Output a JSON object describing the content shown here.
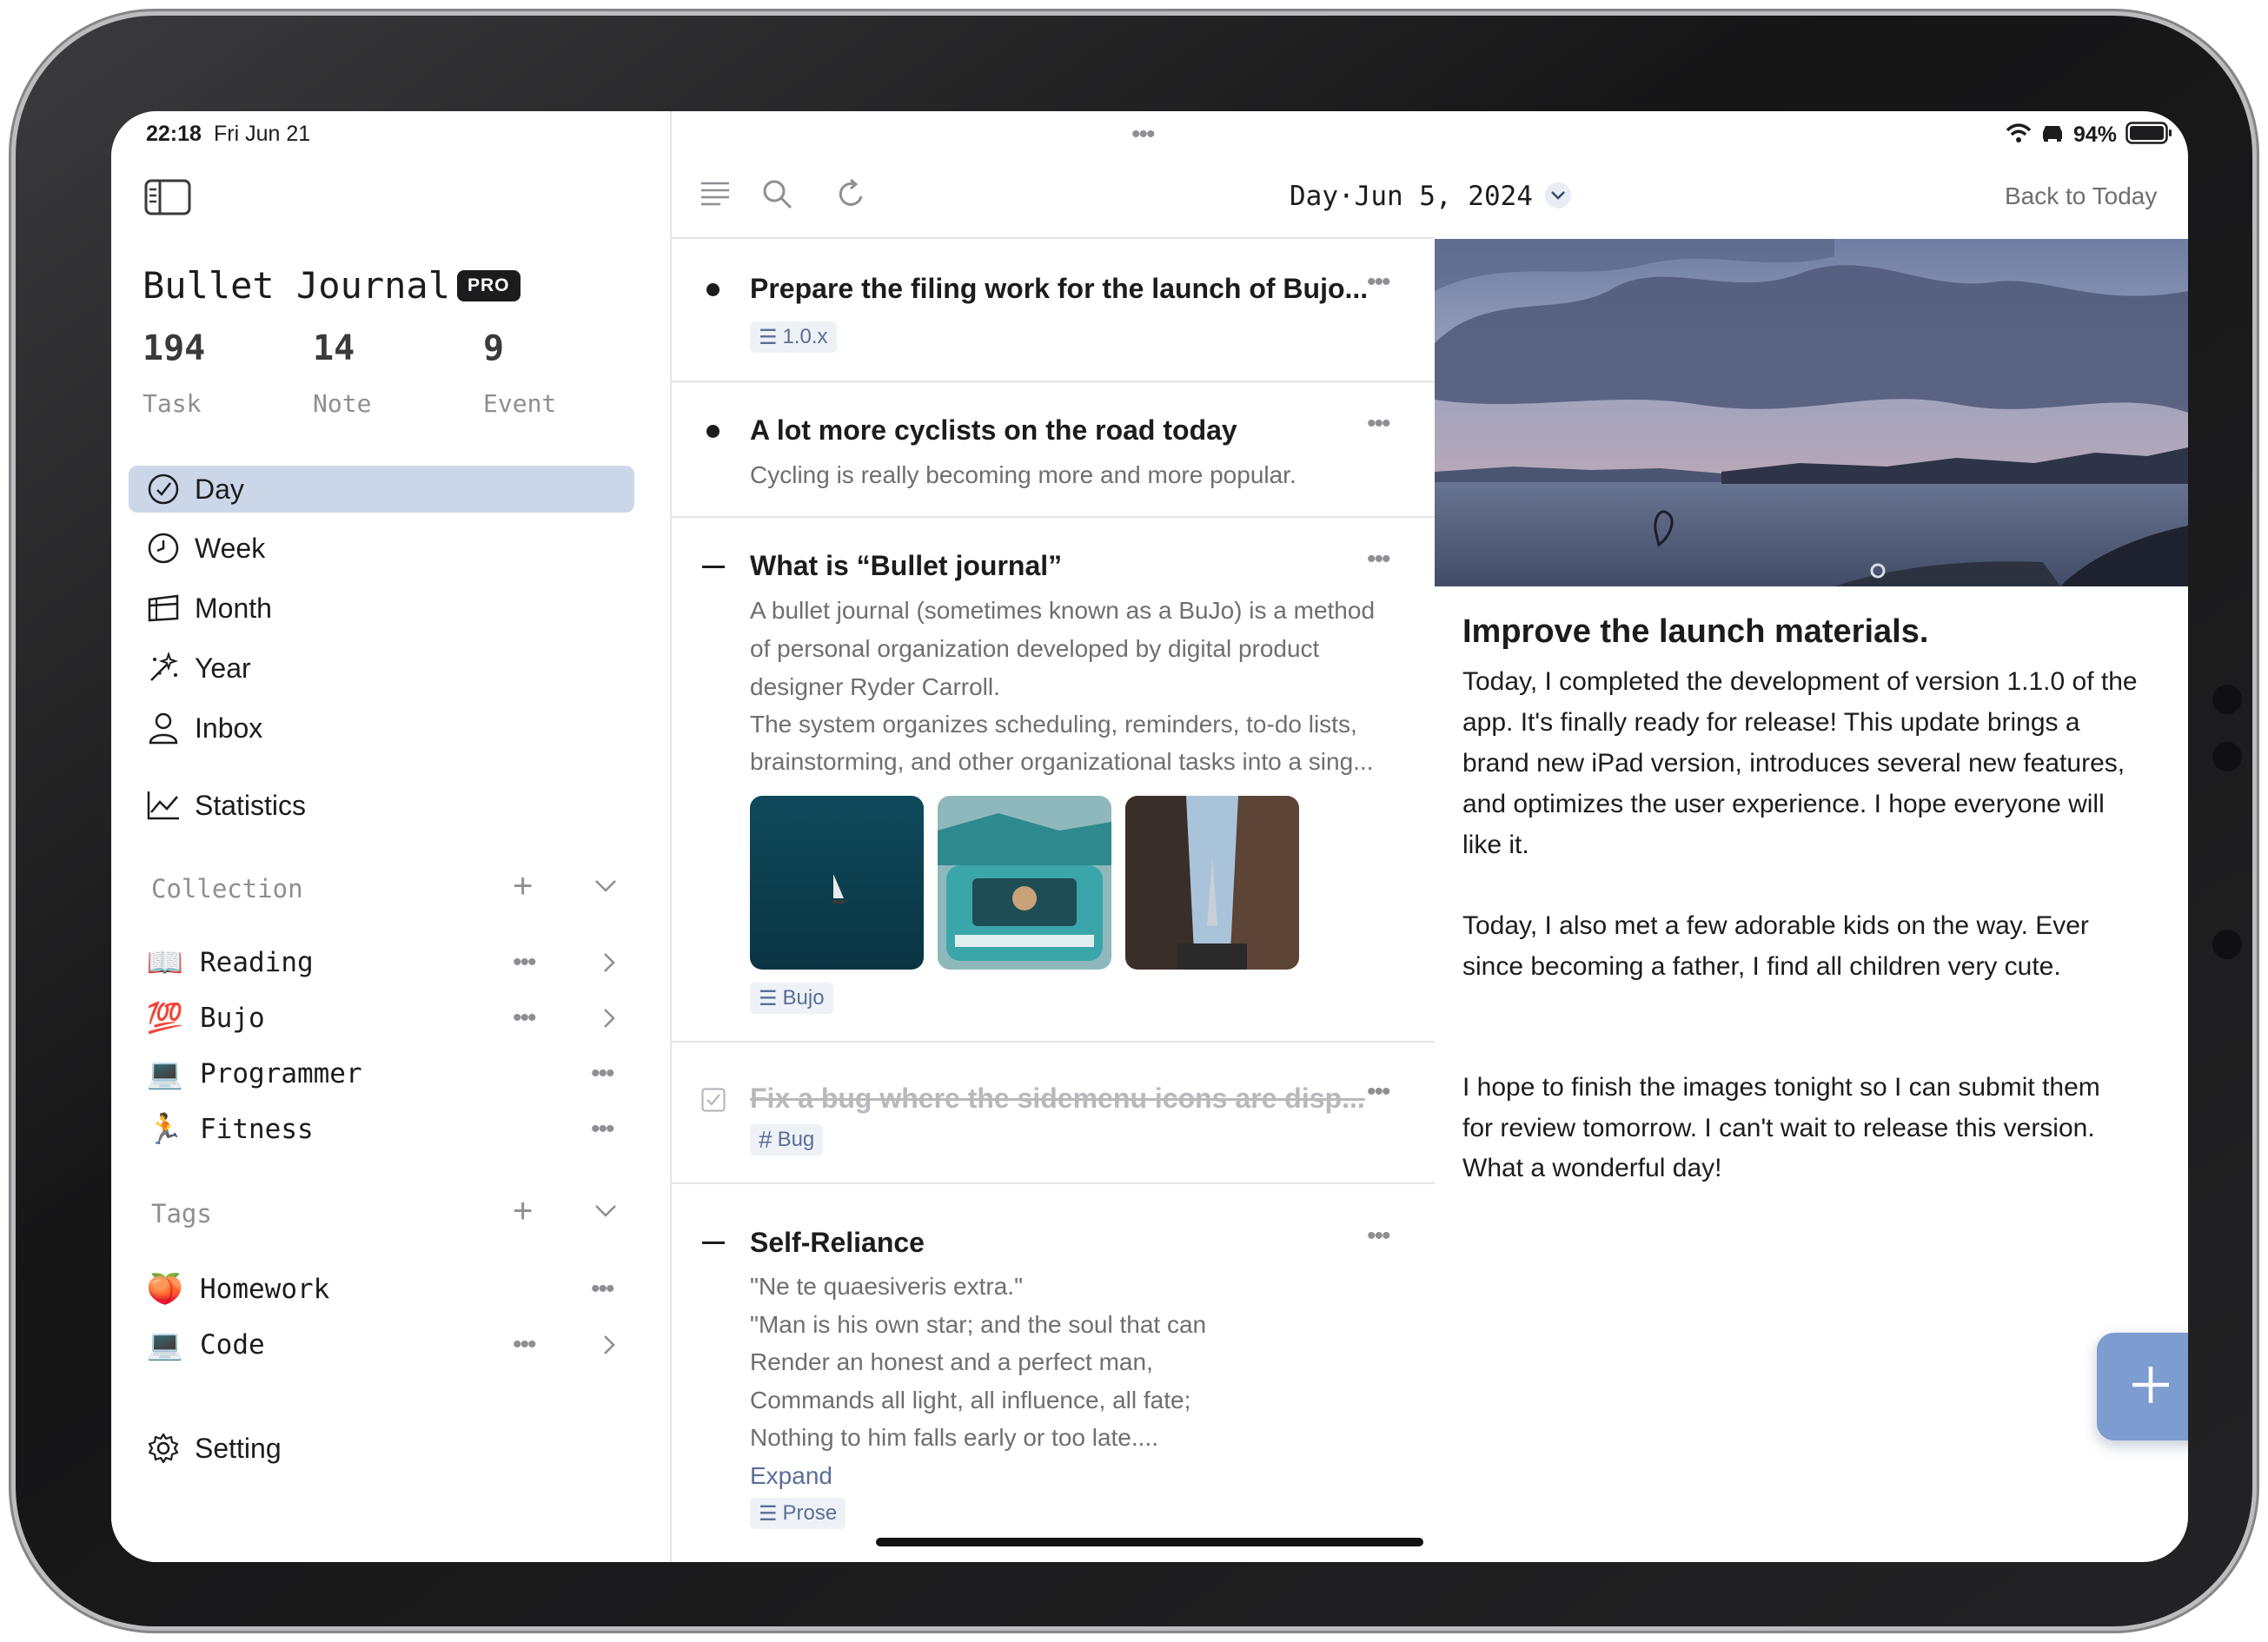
{
  "status_bar": {
    "time": "22:18",
    "date": "Fri Jun 21",
    "battery": "94%"
  },
  "sidebar": {
    "app_title": "Bullet Journal",
    "badge": "PRO",
    "stats": [
      {
        "value": "194",
        "label": "Task"
      },
      {
        "value": "14",
        "label": "Note"
      },
      {
        "value": "9",
        "label": "Event"
      }
    ],
    "nav": [
      {
        "label": "Day",
        "icon": "day-icon",
        "active": true
      },
      {
        "label": "Week",
        "icon": "clock-icon"
      },
      {
        "label": "Month",
        "icon": "month-icon"
      },
      {
        "label": "Year",
        "icon": "sparkles-icon"
      },
      {
        "label": "Inbox",
        "icon": "person-icon"
      }
    ],
    "statistics_label": "Statistics",
    "collection": {
      "title": "Collection",
      "items": [
        {
          "emoji": "📖",
          "label": "Reading"
        },
        {
          "emoji": "💯",
          "label": "Bujo"
        },
        {
          "emoji": "💻",
          "label": "Programmer"
        },
        {
          "emoji": "🏃",
          "label": "Fitness"
        }
      ]
    },
    "tags": {
      "title": "Tags",
      "items": [
        {
          "emoji": "🍑",
          "label": "Homework"
        },
        {
          "emoji": "💻",
          "label": "Code"
        }
      ]
    },
    "setting_label": "Setting"
  },
  "toolbar": {
    "date_label": "Day·Jun 5, 2024",
    "back_to_today": "Back to Today"
  },
  "entries": [
    {
      "type": "task",
      "title": "Prepare the filing work for the launch of Bujo...",
      "tag": "1.0.x"
    },
    {
      "type": "task",
      "title": "A lot more cyclists on the road today",
      "body": [
        "Cycling is really becoming more and more popular."
      ]
    },
    {
      "type": "note",
      "title": "What is “Bullet journal”",
      "body": [
        "A bullet journal (sometimes known as a BuJo) is a method",
        "of personal organization developed by digital product",
        "designer Ryder Carroll.",
        "The system organizes scheduling, reminders, to-do lists,",
        "brainstorming, and other organizational tasks into a sing..."
      ],
      "tag": "Bujo"
    },
    {
      "type": "done",
      "title": "Fix a bug where the sidemenu icons are disp...",
      "tag": "Bug"
    },
    {
      "type": "note",
      "title": "Self-Reliance",
      "body": [
        "\"Ne te quaesiveris extra.\"",
        "\"Man is his own star; and the soul that can",
        "Render an honest and a perfect man,",
        "Commands all light, all influence, all fate;",
        "Nothing to him falls early or too late...."
      ],
      "expand": "Expand",
      "tag": "Prose"
    }
  ],
  "detail": {
    "title": "Improve the launch materials.",
    "paragraphs": [
      [
        "Today, I completed the development of version 1.1.0 of the",
        "app. It's finally ready for release! This update brings a",
        "brand new iPad version, introduces several new features,",
        "and optimizes the user experience. I hope everyone will",
        "like it."
      ],
      [
        "Today, I also met a few adorable kids on the way. Ever",
        "since becoming a father, I find all children very cute."
      ],
      [
        "I hope to finish the images tonight so I can submit them",
        "for review tomorrow. I can't wait to release this version."
      ],
      [
        "What a wonderful day!"
      ]
    ]
  },
  "colors": {
    "accent": "#7d9ccf",
    "active_bg": "#cbd7e8",
    "tag_bg": "#eef1f6"
  }
}
